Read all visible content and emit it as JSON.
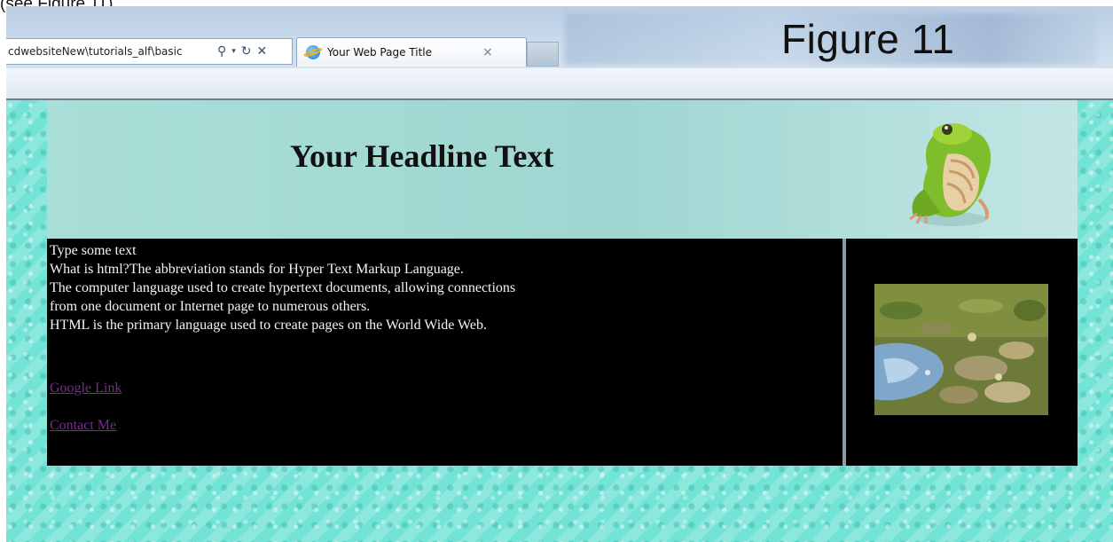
{
  "caption": {
    "top_left_text": "(see Figure 11)",
    "figure_label": "Figure 11"
  },
  "browser": {
    "address": "cdwebsiteNew\\tutorials_alf\\basic",
    "address_icons": [
      "search-icon",
      "dropdown-icon",
      "refresh-icon",
      "stop-icon"
    ],
    "tab_title": "Your Web Page Title",
    "tab_close": "×"
  },
  "page": {
    "headline": "Your Headline Text",
    "body_lines": [
      "Type some text",
      "What is html?The abbreviation stands for Hyper Text Markup Language.",
      "The computer language used to create hypertext documents, allowing connections",
      "from one document or Internet page to numerous others.",
      "HTML is the primary language used to create pages on the World Wide Web."
    ],
    "links": {
      "google": "Google Link",
      "contact": "Contact Me"
    },
    "colors": {
      "background": "#73e3d6",
      "content_background": "#000000",
      "link": "#7a2a96"
    }
  }
}
